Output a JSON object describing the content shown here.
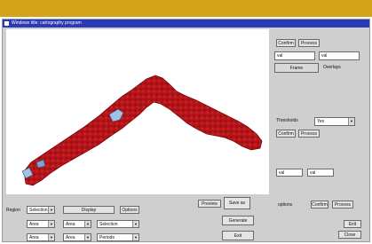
{
  "window": {
    "title": "Windows title: cartography program"
  },
  "right_panel": {
    "btn_top1": "Confirm",
    "btn_top2": "Process",
    "field1": "val",
    "field2": "val",
    "btn_wide": "Frame",
    "side_label": "Overlays",
    "thresholds_label": "Thresholds",
    "thresholds_value": "Yes",
    "btn_mid1": "Confirm",
    "btn_mid2": "Process",
    "field3": "val",
    "field4": "val",
    "options_label": "options",
    "btn_low1": "Confirm",
    "btn_low2": "Process",
    "btn_low3": "Exit",
    "btn_low4": "Close"
  },
  "bottom_panel": {
    "region_label": "Region",
    "region_value": "Selection",
    "btn_display": "Display",
    "btn_options": "Options",
    "btn_preview": "Preview",
    "btn_save_as": "Save as",
    "btn_generate": "Generate",
    "btn_exit": "Exit",
    "rows": [
      {
        "a": "Area",
        "b": "Area",
        "c": "Selection"
      },
      {
        "a": "Area",
        "b": "Area",
        "c": "Periods"
      }
    ]
  },
  "colors": {
    "map_dark": "#8c0f10",
    "map_mid": "#c0151b",
    "map_light": "#e2393c",
    "highlight": "#9fc2e6",
    "title_bar": "#2c39b5",
    "top_band": "#d4a418"
  }
}
